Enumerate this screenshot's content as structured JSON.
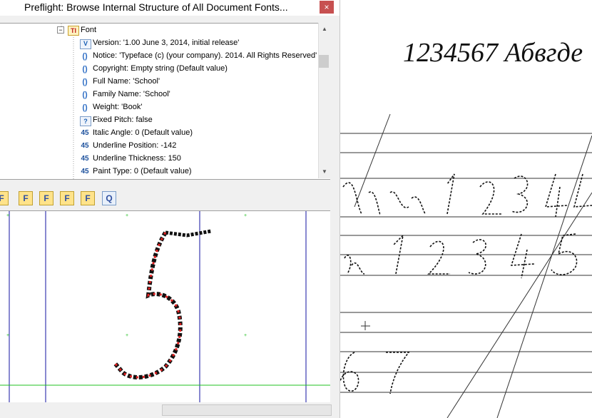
{
  "window": {
    "title": "Preflight: Browse Internal Structure of All Document Fonts..."
  },
  "tree": {
    "root": {
      "label": "Font",
      "icon": "font-node-icon"
    },
    "items": [
      {
        "label": "Version: '1.00 June 3, 2014, initial release'",
        "icon": "string-value-icon"
      },
      {
        "label": "Notice: 'Typeface (c) (your company). 2014. All Rights Reserved'",
        "icon": "paren-value-icon"
      },
      {
        "label": "Copyright: Empty string (Default value)",
        "icon": "paren-value-icon"
      },
      {
        "label": "Full Name: 'School'",
        "icon": "paren-value-icon"
      },
      {
        "label": "Family Name: 'School'",
        "icon": "paren-value-icon"
      },
      {
        "label": "Weight: 'Book'",
        "icon": "paren-value-icon"
      },
      {
        "label": "Fixed Pitch: false",
        "icon": "boolean-value-icon"
      },
      {
        "label": "Italic Angle: 0 (Default value)",
        "icon": "number-value-icon"
      },
      {
        "label": "Underline Position: -142",
        "icon": "number-value-icon"
      },
      {
        "label": "Underline Thickness: 150",
        "icon": "number-value-icon"
      },
      {
        "label": "Paint Type: 0 (Default value)",
        "icon": "number-value-icon"
      }
    ]
  },
  "icons": {
    "string": "V",
    "paren": "()",
    "boolean": "?",
    "number": "45",
    "font": "TI",
    "close": "×",
    "collapse": "−"
  },
  "toolbar": {
    "buttons": [
      "F",
      "F",
      "F",
      "F",
      "F",
      "Q"
    ]
  },
  "preview": {
    "sample_text": "1234567 Абвгде"
  }
}
